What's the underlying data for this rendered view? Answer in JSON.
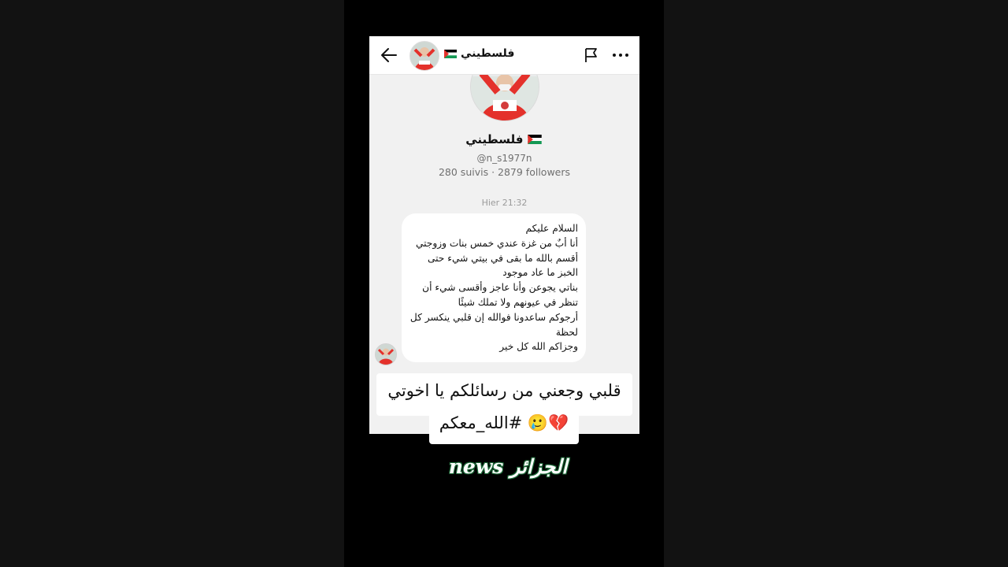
{
  "header": {
    "name": "فلسطيني",
    "flag": "palestine-flag"
  },
  "profile": {
    "name": "فلسطيني",
    "handle": "@n_s1977n",
    "stats": "280 suivis · 2879 followers"
  },
  "message": {
    "time": "Hier 21:32",
    "lines": [
      "السلام عليكم",
      "أنا أبٌ من غزة عندي خمس بنات وزوجتي",
      "أقسم بالله ما بقى في بيتي شيء حتى",
      "الخبز ما عاد موجود",
      "بناتي يجوعن وأنا عاجز وأقسى شيء أن",
      "تنظر في عيونهم ولا تملك شيئًا",
      "أرجوكم ساعدونا فوالله إن قلبي ينكسر كل",
      "لحظة",
      "وجزاكم الله كل خير"
    ]
  },
  "caption": {
    "line1": "قلبي وجعني من رسائلكم يا اخوتي",
    "line2": "💔🥲 #الله_معكم"
  },
  "watermark": "الجزائر news",
  "colors": {
    "flag_red": "#e4312b",
    "flag_green": "#149954",
    "flag_black": "#000000",
    "watermark_outline": "#1e6b3a"
  }
}
